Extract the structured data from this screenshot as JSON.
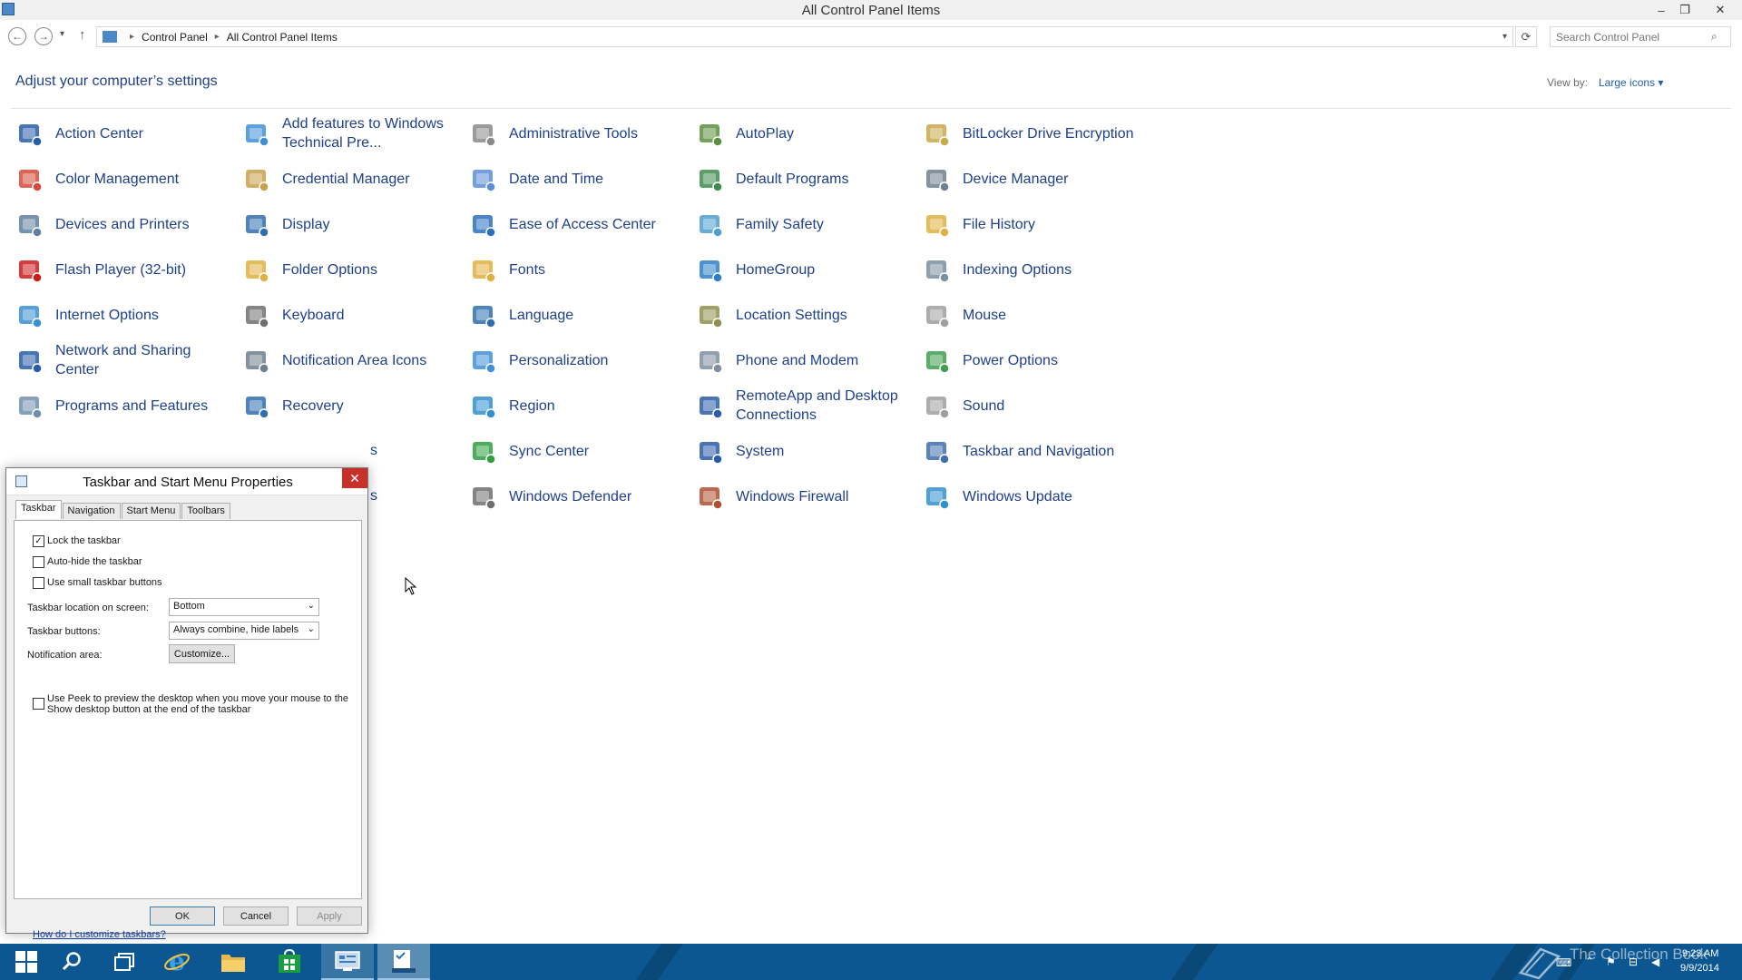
{
  "window": {
    "title": "All Control Panel Items",
    "controls": [
      "–",
      "❐",
      "✕"
    ]
  },
  "address": {
    "crumbs": [
      "Control Panel",
      "All Control Panel Items"
    ],
    "search_placeholder": "Search Control Panel"
  },
  "header": {
    "title": "Adjust your computer’s settings",
    "view_by_label": "View by:",
    "view_by_value": "Large icons ▾"
  },
  "items": [
    [
      "Action Center",
      "Add features to Windows Technical Pre...",
      "Administrative Tools",
      "AutoPlay",
      "BitLocker Drive Encryption"
    ],
    [
      "Color Management",
      "Credential Manager",
      "Date and Time",
      "Default Programs",
      "Device Manager"
    ],
    [
      "Devices and Printers",
      "Display",
      "Ease of Access Center",
      "Family Safety",
      "File History"
    ],
    [
      "Flash Player (32-bit)",
      "Folder Options",
      "Fonts",
      "HomeGroup",
      "Indexing Options"
    ],
    [
      "Internet Options",
      "Keyboard",
      "Language",
      "Location Settings",
      "Mouse"
    ],
    [
      "Network and Sharing Center",
      "Notification Area Icons",
      "Personalization",
      "Phone and Modem",
      "Power Options"
    ],
    [
      "Programs and Features",
      "Recovery",
      "Region",
      "RemoteApp and Desktop Connections",
      "Sound"
    ],
    [
      "",
      "",
      "Sync Center",
      "System",
      "Taskbar and Navigation"
    ],
    [
      "",
      "",
      "Windows Defender",
      "Windows Firewall",
      "Windows Update"
    ]
  ],
  "partial_labels": {
    "row8_col2": "s",
    "row9_col2": "s"
  },
  "dialog": {
    "title": "Taskbar and Start Menu Properties",
    "close": "✕",
    "tabs": [
      "Taskbar",
      "Navigation",
      "Start Menu",
      "Toolbars"
    ],
    "lock": "Lock the taskbar",
    "autohide": "Auto-hide the taskbar",
    "small_buttons": "Use small taskbar buttons",
    "location_label": "Taskbar location on screen:",
    "location_value": "Bottom",
    "buttons_label": "Taskbar buttons:",
    "buttons_value": "Always combine, hide labels",
    "notif_label": "Notification area:",
    "customize": "Customize...",
    "peek_line1": "Use Peek to preview the desktop when you move your mouse to the",
    "peek_line2": "Show desktop button at the end of the taskbar",
    "help": "How do I customize taskbars?",
    "ok": "OK",
    "cancel": "Cancel",
    "apply": "Apply"
  },
  "taskbar": {
    "time": "9:23 AM",
    "date": "9/9/2014",
    "watermark": "The Collection Book"
  },
  "colors": {
    "link": "#1e3f8c",
    "taskbar": "#0c5791",
    "close": "#c7312a"
  }
}
